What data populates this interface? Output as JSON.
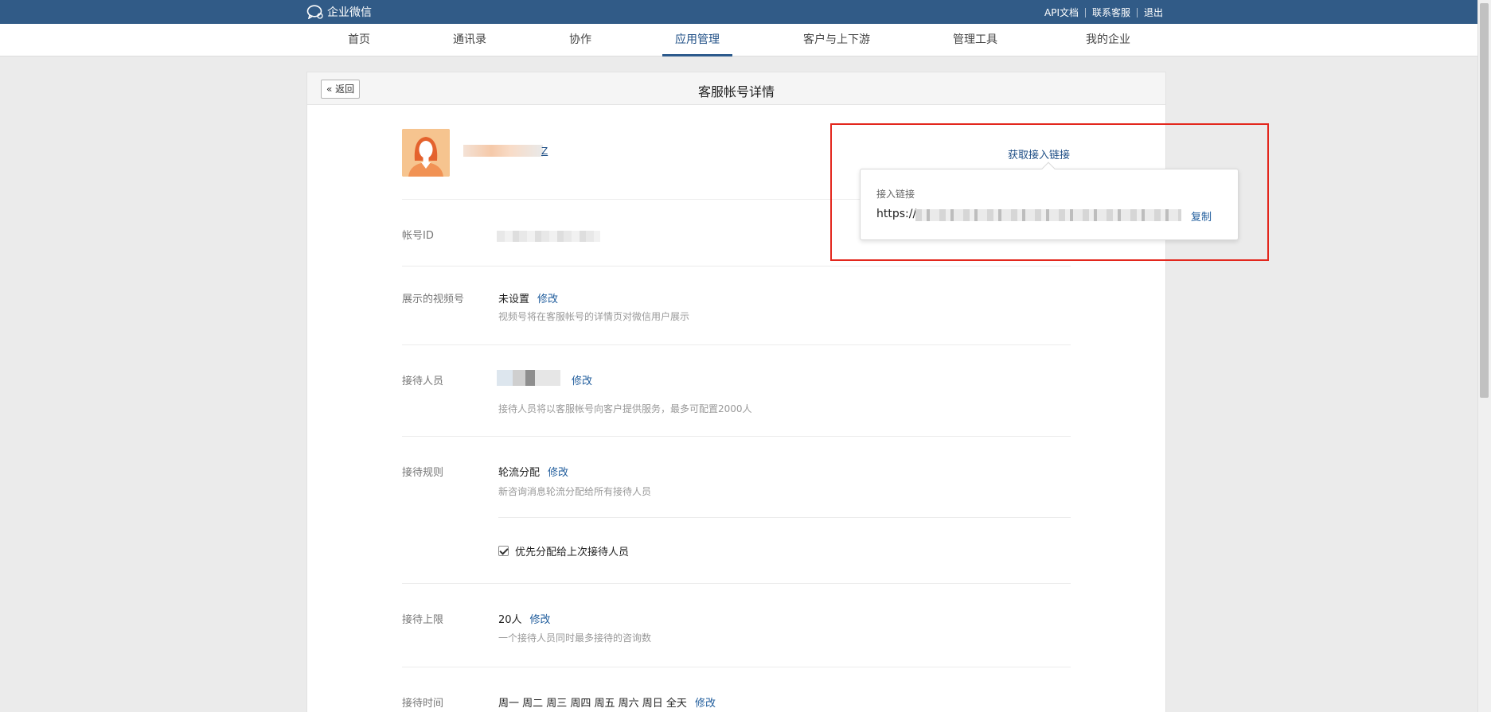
{
  "topbar": {
    "logo_text": "企业微信",
    "links": [
      "API文档",
      "联系客服",
      "退出"
    ]
  },
  "nav": {
    "items": [
      "首页",
      "通讯录",
      "协作",
      "应用管理",
      "客户与上下游",
      "管理工具",
      "我的企业"
    ],
    "active": "应用管理"
  },
  "page": {
    "back_label": "返回",
    "title": "客服帐号详情"
  },
  "profile": {
    "name_suffix": "Z"
  },
  "account_id": {
    "label": "帐号ID"
  },
  "video_channel": {
    "label": "展示的视频号",
    "value": "未设置",
    "edit": "修改",
    "hint": "视频号将在客服帐号的详情页对微信用户展示"
  },
  "receptionist": {
    "label": "接待人员",
    "edit": "修改",
    "hint": "接待人员将以客服帐号向客户提供服务，最多可配置2000人"
  },
  "rules": {
    "label": "接待规则",
    "value": "轮流分配",
    "edit": "修改",
    "hint": "新咨询消息轮流分配给所有接待人员"
  },
  "priority": {
    "label": "优先分配给上次接待人员",
    "checked": true
  },
  "limit": {
    "label": "接待上限",
    "value": "20人",
    "edit": "修改",
    "hint": "一个接待人员同时最多接待的咨询数"
  },
  "schedule": {
    "label": "接待时间",
    "value": "周一 周二 周三 周四 周五 周六 周日 全天",
    "edit": "修改"
  },
  "link_popover": {
    "trigger": "获取接入链接",
    "title": "接入链接",
    "url_prefix": "https://",
    "copy": "复制"
  },
  "colors": {
    "topbar": "#315b87",
    "accent": "#1f4f86",
    "highlight_box": "#e3271d"
  }
}
